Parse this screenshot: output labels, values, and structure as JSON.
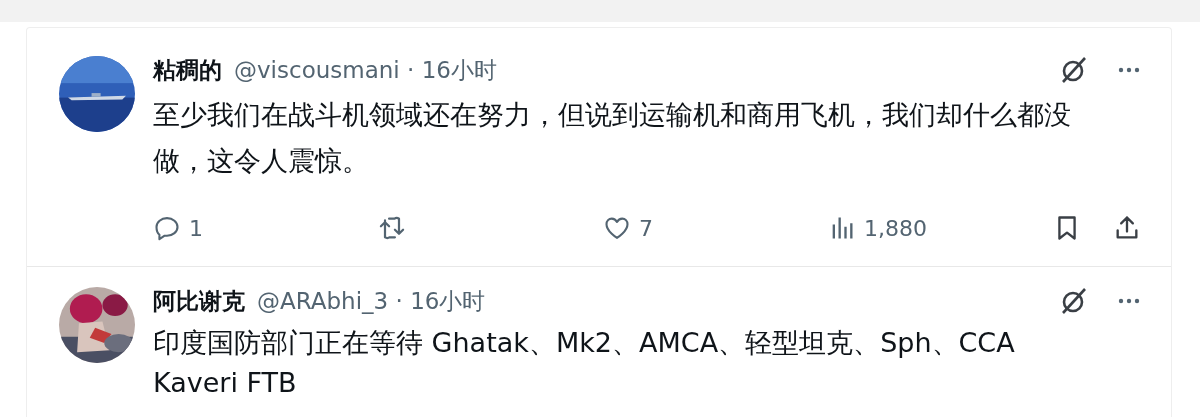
{
  "tweets": [
    {
      "name": "粘稠的",
      "meta": "@viscousmani · 16小时",
      "text": "至少我们在战斗机领域还在努力，但说到运输机和商用飞机，我们却什么都没做，这令人震惊。",
      "actions": [
        {
          "kind": "reply",
          "count": "1"
        },
        {
          "kind": "repost"
        },
        {
          "kind": "like",
          "count": "7"
        },
        {
          "kind": "views",
          "count": "1,880"
        },
        {
          "kind": "bookmark"
        },
        {
          "kind": "share"
        }
      ]
    },
    {
      "name": "阿比谢克",
      "meta": "@ARAbhi_3 · 16小时",
      "text": "印度国防部门正在等待 Ghatak、Mk2、AMCA、轻型坦克、Sph、CCA Kaveri FTB"
    }
  ]
}
